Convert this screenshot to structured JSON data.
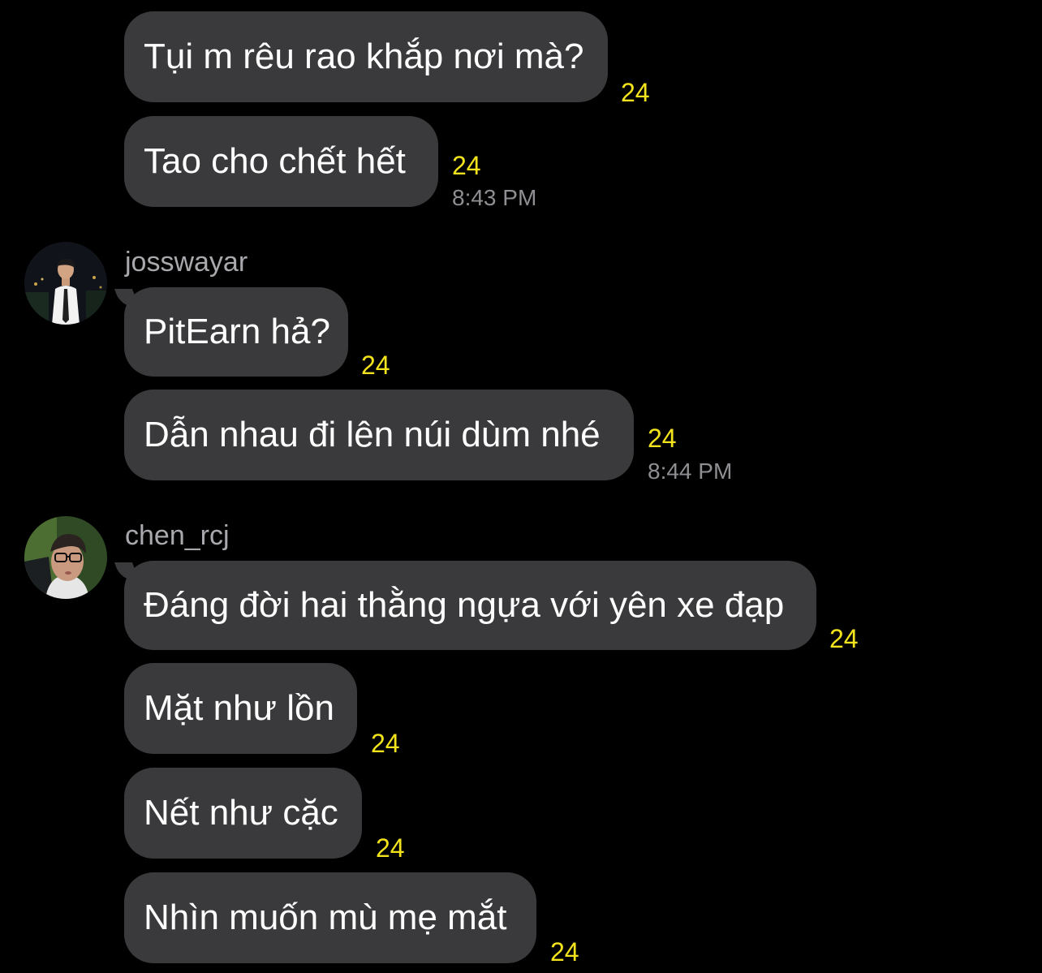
{
  "messages": [
    {
      "text": "Tụi m rêu rao khắp nơi mà?",
      "badge": "24"
    },
    {
      "text": "Tao cho chết hết",
      "badge": "24",
      "time": "8:43 PM"
    },
    {
      "text": "PitEarn hả?",
      "badge": "24"
    },
    {
      "text": "Dẫn nhau đi lên núi dùm nhé",
      "badge": "24",
      "time": "8:44 PM"
    },
    {
      "text": "Đáng đời hai thằng ngựa với yên xe đạp",
      "badge": "24"
    },
    {
      "text": "Mặt như lồn",
      "badge": "24"
    },
    {
      "text": "Nết như cặc",
      "badge": "24"
    },
    {
      "text": "Nhìn muốn mù mẹ mắt",
      "badge": "24"
    }
  ],
  "senders": [
    {
      "username": "josswayar"
    },
    {
      "username": "chen_rcj"
    }
  ],
  "colors": {
    "background": "#000000",
    "bubble": "#3a3a3c",
    "badge": "#f2e31c",
    "timestamp": "#8e8e93"
  }
}
